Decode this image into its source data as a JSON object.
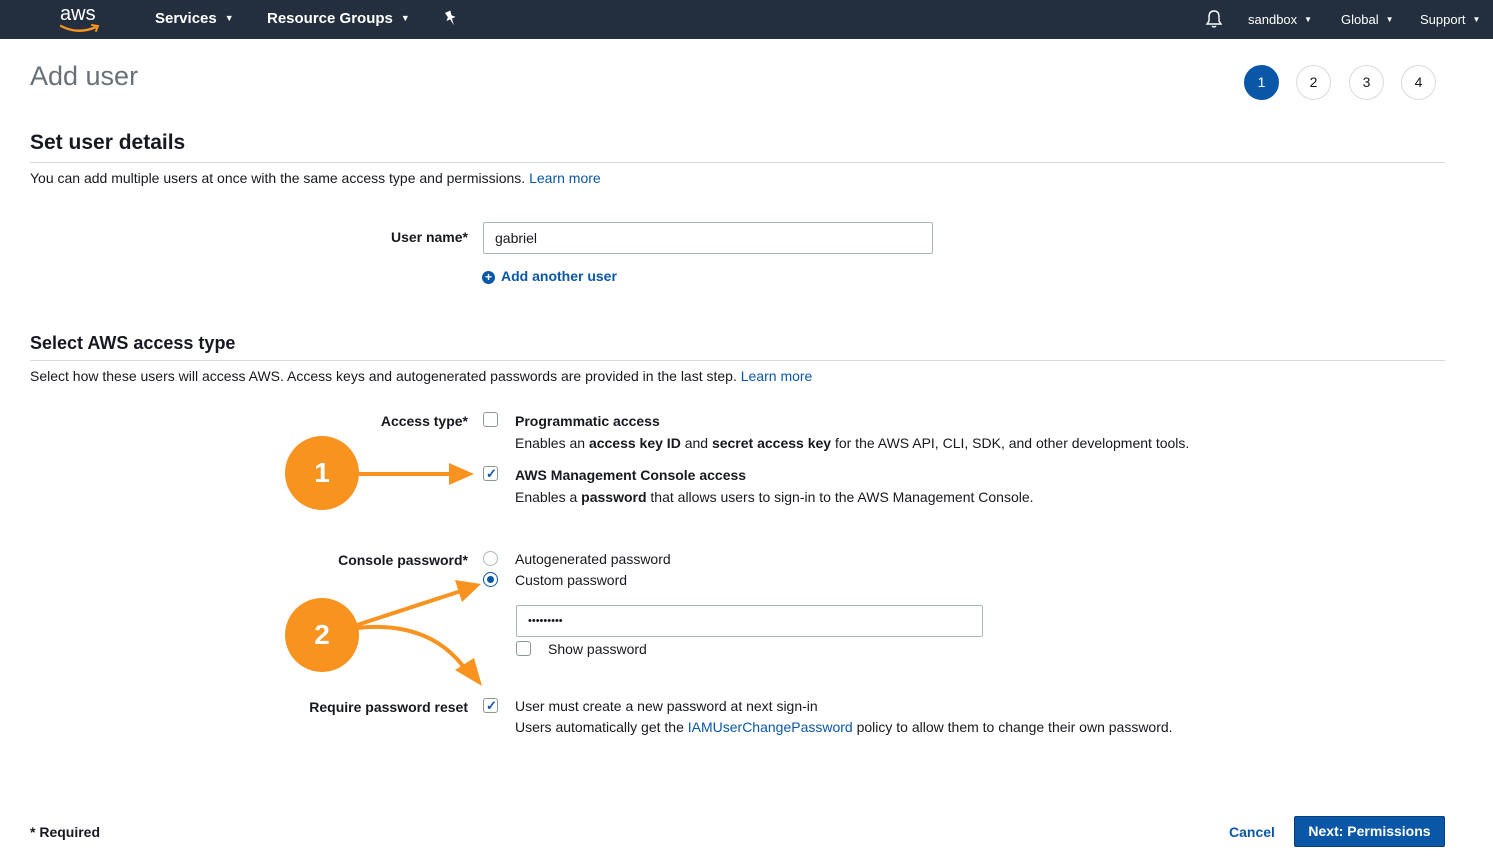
{
  "nav": {
    "logo": "aws",
    "services": "Services",
    "resource_groups": "Resource Groups",
    "account": "sandbox",
    "region": "Global",
    "support": "Support",
    "icons": [
      "pin-icon",
      "bell-icon"
    ]
  },
  "page": {
    "title": "Add user",
    "steps": [
      "1",
      "2",
      "3",
      "4"
    ],
    "active_step": "1"
  },
  "details": {
    "title": "Set user details",
    "description": "You can add multiple users at once with the same access type and permissions.",
    "learn_more": "Learn more",
    "user_name_label": "User name*",
    "user_name_value": "gabriel",
    "add_another_user": "Add another user"
  },
  "access": {
    "title": "Select AWS access type",
    "description": "Select how these users will access AWS. Access keys and autogenerated passwords are provided in the last step.",
    "learn_more": "Learn more",
    "access_type_label": "Access type*",
    "programmatic": {
      "title": "Programmatic access",
      "checked": false,
      "desc_1": "Enables an ",
      "desc_b1": "access key ID",
      "desc_2": " and ",
      "desc_b2": "secret access key",
      "desc_3": " for the AWS API, CLI, SDK, and other development tools."
    },
    "console": {
      "title": "AWS Management Console access",
      "checked": true,
      "desc_1": "Enables a ",
      "desc_b1": "password",
      "desc_2": " that allows users to sign-in to the AWS Management Console."
    },
    "console_password_label": "Console password*",
    "autogenerated": "Autogenerated password",
    "custom": "Custom password",
    "password_value": "•••••••••",
    "show_password": "Show password",
    "require_reset_label": "Require password reset",
    "require_reset_text": "User must create a new password at next sign-in",
    "reset_desc_1": "Users automatically get the ",
    "reset_link": "IAMUserChangePassword",
    "reset_desc_2": " policy to allow them to change their own password."
  },
  "annotations": {
    "callout_1": "1",
    "callout_2": "2",
    "color": "#f7931e"
  },
  "footer": {
    "required": "* Required",
    "cancel": "Cancel",
    "next": "Next: Permissions"
  },
  "colors": {
    "nav_bg": "#232f3e",
    "primary": "#0a57a8",
    "accent": "#f7931e"
  }
}
